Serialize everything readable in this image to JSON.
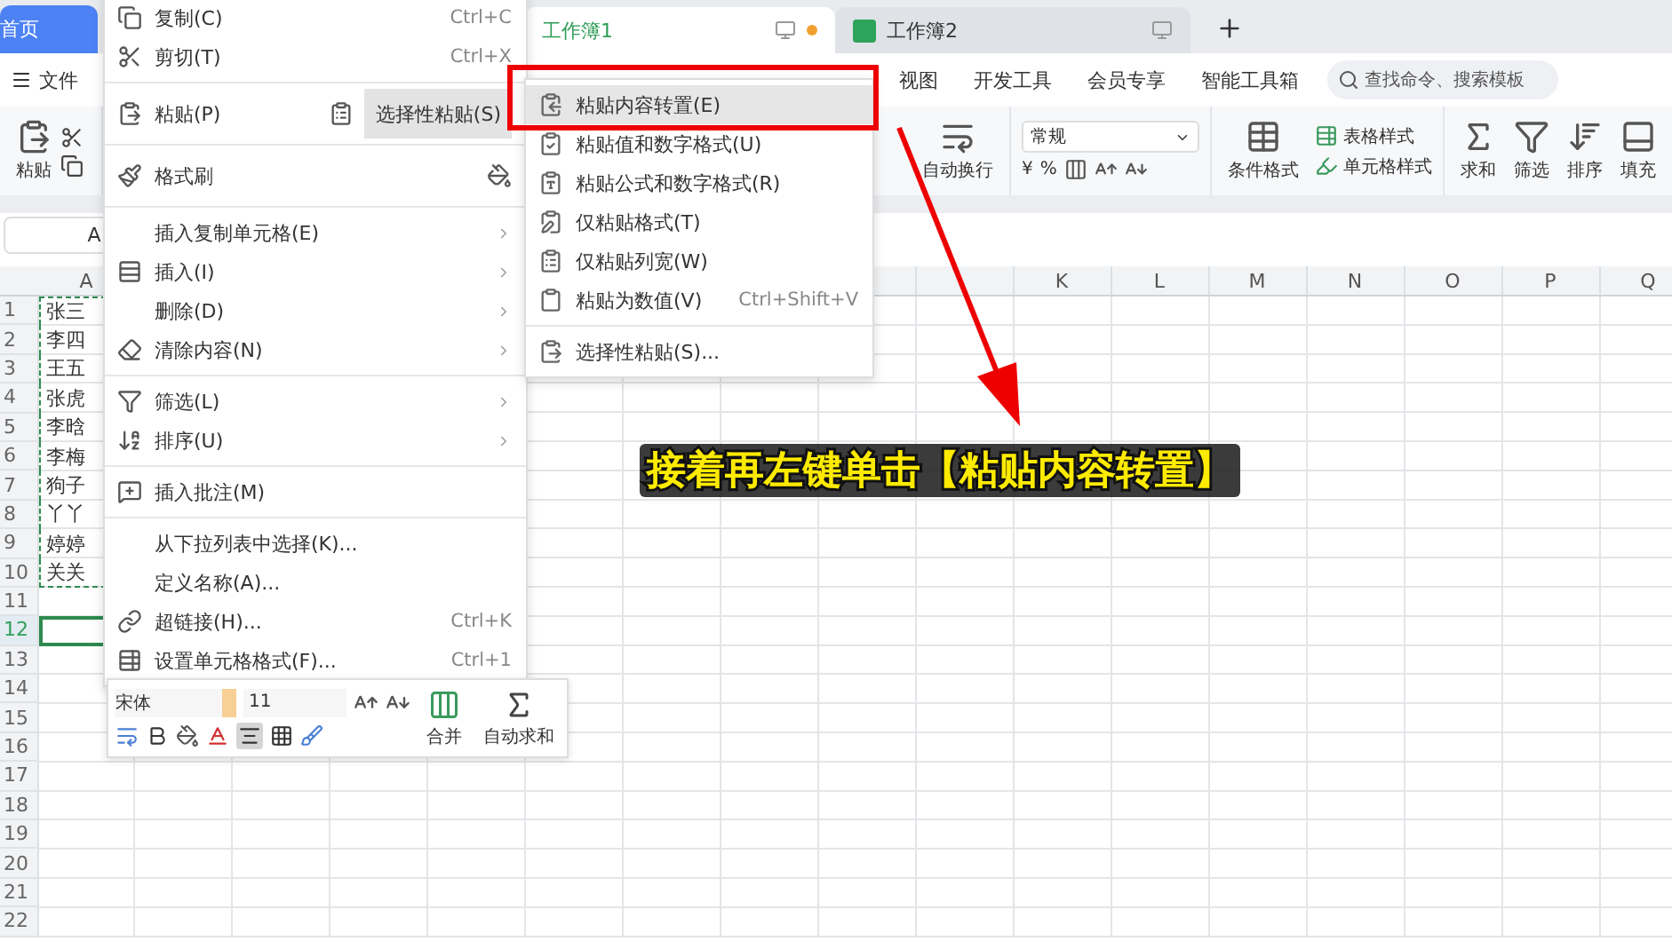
{
  "tabs": [
    {
      "label": "首页",
      "kind": "home",
      "selected": false
    },
    {
      "label": "工作簿1",
      "kind": "doc",
      "selected": true,
      "modified": true
    },
    {
      "label": "工作簿2",
      "kind": "doc",
      "selected": false,
      "modified": false
    }
  ],
  "menu_bar": {
    "file": "文件",
    "tabs": [
      "视图",
      "开发工具",
      "会员专享",
      "智能工具箱"
    ],
    "search": {
      "placeholder": "查找命令、搜索模板"
    }
  },
  "ribbon": {
    "paste": "粘贴",
    "wrap": "自动换行",
    "number_format": "常规",
    "currency": "¥",
    "percent": "%",
    "conditional": "条件格式",
    "table_style": "表格样式",
    "cell_style": "单元格样式",
    "tools": [
      "求和",
      "筛选",
      "排序",
      "填充"
    ]
  },
  "name_box": "A",
  "columns": [
    "A",
    "K",
    "L",
    "M",
    "N",
    "O",
    "P",
    "Q"
  ],
  "rows": [
    {
      "number": "1",
      "value": "张三",
      "selected": false
    },
    {
      "number": "2",
      "value": "李四",
      "selected": false
    },
    {
      "number": "3",
      "value": "王五",
      "selected": false
    },
    {
      "number": "4",
      "value": "张虎",
      "selected": false
    },
    {
      "number": "5",
      "value": "李晗",
      "selected": false
    },
    {
      "number": "6",
      "value": "李梅",
      "selected": false
    },
    {
      "number": "7",
      "value": "狗子",
      "selected": false
    },
    {
      "number": "8",
      "value": "丫丫",
      "selected": false
    },
    {
      "number": "9",
      "value": "婷婷",
      "selected": false
    },
    {
      "number": "10",
      "value": "关关",
      "selected": false
    },
    {
      "number": "11",
      "selected": false
    },
    {
      "number": "12",
      "selected": true
    },
    {
      "number": "13",
      "selected": false
    },
    {
      "number": "14",
      "selected": false
    },
    {
      "number": "15",
      "selected": false
    },
    {
      "number": "16",
      "selected": false
    },
    {
      "number": "17",
      "selected": false
    },
    {
      "number": "18",
      "selected": false
    },
    {
      "number": "19",
      "selected": false
    },
    {
      "number": "20",
      "selected": false
    },
    {
      "number": "21",
      "selected": false
    },
    {
      "number": "22",
      "selected": false
    }
  ],
  "context_menu": {
    "groups": [
      [
        {
          "kind": "plain",
          "label": "复制(C)",
          "shortcut": "Ctrl+C",
          "submenu": false,
          "selected": false
        },
        {
          "kind": "plain",
          "label": "剪切(T)",
          "shortcut": "Ctrl+X",
          "submenu": false,
          "selected": false
        }
      ],
      [
        {
          "kind": "split",
          "label": "粘贴(P)",
          "submenu": false,
          "selected": false,
          "side": {
            "label": "选择性粘贴(S)",
            "selected": true
          }
        }
      ],
      [
        {
          "kind": "tool",
          "label": "格式刷",
          "submenu": false,
          "selected": false
        }
      ],
      [
        {
          "kind": "plain",
          "label": "插入复制单元格(E)",
          "submenu": true,
          "selected": false
        },
        {
          "kind": "plain",
          "label": "插入(I)",
          "submenu": true,
          "selected": false
        },
        {
          "kind": "plain",
          "label": "删除(D)",
          "submenu": true,
          "selected": false
        },
        {
          "kind": "plain",
          "label": "清除内容(N)",
          "submenu": true,
          "selected": false
        }
      ],
      [
        {
          "kind": "plain",
          "label": "筛选(L)",
          "submenu": true,
          "selected": false
        },
        {
          "kind": "plain",
          "label": "排序(U)",
          "submenu": true,
          "selected": false
        }
      ],
      [
        {
          "kind": "plain",
          "label": "插入批注(M)",
          "submenu": false,
          "selected": false
        }
      ],
      [
        {
          "kind": "plain",
          "label": "从下拉列表中选择(K)...",
          "submenu": false,
          "selected": false
        },
        {
          "kind": "plain",
          "label": "定义名称(A)...",
          "submenu": false,
          "selected": false
        },
        {
          "kind": "plain",
          "label": "超链接(H)...",
          "shortcut": "Ctrl+K",
          "submenu": false,
          "selected": false
        },
        {
          "kind": "plain",
          "label": "设置单元格格式(F)...",
          "shortcut": "Ctrl+1",
          "submenu": false,
          "selected": false
        }
      ]
    ]
  },
  "submenu": {
    "groups": [
      [
        {
          "label": "粘贴内容转置(E)",
          "selected": true
        },
        {
          "label": "粘贴值和数字格式(U)",
          "selected": false
        },
        {
          "label": "粘贴公式和数字格式(R)",
          "selected": false
        },
        {
          "label": "仅粘贴格式(T)",
          "selected": false
        },
        {
          "label": "仅粘贴列宽(W)",
          "selected": false
        },
        {
          "label": "粘贴为数值(V)",
          "shortcut": "Ctrl+Shift+V",
          "selected": false
        }
      ],
      [
        {
          "label": "选择性粘贴(S)...",
          "selected": false
        }
      ]
    ]
  },
  "mini_toolbar": {
    "font": "宋体",
    "size": "11",
    "merge": "合并",
    "autosum": "自动求和"
  },
  "annotation": {
    "text": "接着再左键单击【粘贴内容转置】"
  }
}
